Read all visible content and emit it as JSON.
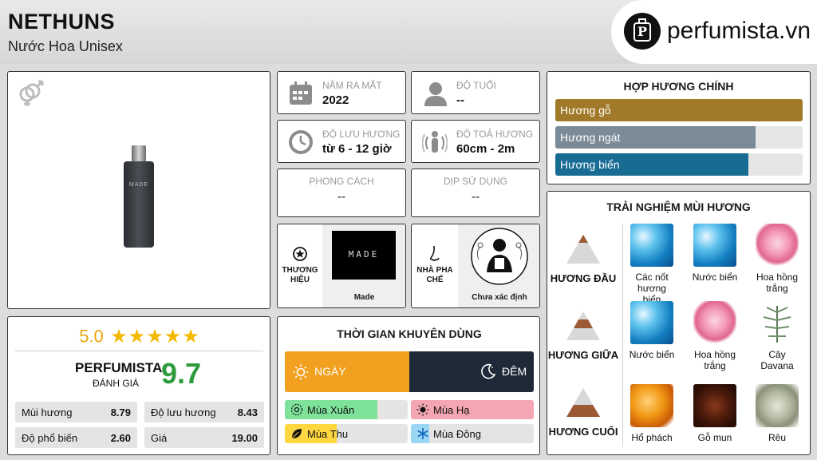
{
  "header": {
    "title": "NETHUNS",
    "subtitle": "Nước Hoa Unisex",
    "logo_text": "perfumista.vn"
  },
  "product": {
    "gender_icon": "unisex-gender-icon",
    "bottle_label": "MADE"
  },
  "rating": {
    "score": "5.0",
    "stars": 5,
    "perfumista_label": "PERFUMISTA",
    "review_label": "ĐÁNH GIÁ",
    "perfumista_score": "9.7",
    "stats": [
      {
        "label": "Mùi hương",
        "value": "8.79"
      },
      {
        "label": "Độ lưu hương",
        "value": "8.43"
      },
      {
        "label": "Độ phổ biến",
        "value": "2.60"
      },
      {
        "label": "Giá",
        "value": "19.00"
      }
    ]
  },
  "info": {
    "year_label": "NĂM RA MẮT",
    "year_value": "2022",
    "age_label": "ĐỘ TUỔI",
    "age_value": "--",
    "longevity_label": "ĐỘ LƯU HƯƠNG",
    "longevity_value": "từ 6 - 12 giờ",
    "sillage_label": "ĐỘ TOẢ HƯƠNG",
    "sillage_value": "60cm - 2m",
    "style_label": "PHONG CÁCH",
    "style_value": "--",
    "occasion_label": "DỊP SỬ DỤNG",
    "occasion_value": "--",
    "brand_label_1": "THƯƠNG",
    "brand_label_2": "HIỆU",
    "brand_name": "Made",
    "brand_logo_text": "MADE",
    "perfumer_label_1": "NHÀ PHA",
    "perfumer_label_2": "CHẾ",
    "perfumer_name": "Chưa xác định"
  },
  "time": {
    "title": "THỜI GIAN KHUYÊN DÙNG",
    "day_label": "NGÀY",
    "night_label": "ĐÊM",
    "day_share": 0.5,
    "seasons": [
      {
        "label": "Mùa Xuân",
        "level": 0.75,
        "color": "#7ee29a",
        "icon": "flower-icon"
      },
      {
        "label": "Mùa Hạ",
        "level": 1.0,
        "color": "#f4a6b2",
        "icon": "sun-icon"
      },
      {
        "label": "Mùa Thu",
        "level": 0.42,
        "color": "#ffd740",
        "icon": "leaf-icon"
      },
      {
        "label": "Mùa Đông",
        "level": 0.15,
        "color": "#9ad7f3",
        "icon": "snowflake-icon"
      }
    ]
  },
  "accords": {
    "title": "HỢP HƯƠNG CHÍNH",
    "items": [
      {
        "label": "Hương gỗ",
        "level": 1.0,
        "color": "#a07a2a"
      },
      {
        "label": "Hương ngát",
        "level": 0.81,
        "color": "#7a8a97"
      },
      {
        "label": "Hương biển",
        "level": 0.78,
        "color": "#186c94"
      }
    ]
  },
  "notes": {
    "title": "TRẢI NGHIỆM MÙI HƯƠNG",
    "top_label": "HƯƠNG ĐẦU",
    "middle_label": "HƯƠNG GIỮA",
    "base_label": "HƯƠNG CUỐI",
    "top": [
      {
        "label": "Các nốt hương biển",
        "img": "wave"
      },
      {
        "label": "Nước biển",
        "img": "wave"
      },
      {
        "label": "Hoa hồng trắng",
        "img": "rose"
      }
    ],
    "middle": [
      {
        "label": "Nước biển",
        "img": "wave"
      },
      {
        "label": "Hoa hồng trắng",
        "img": "rose"
      },
      {
        "label": "Cây Davana",
        "img": "herb"
      }
    ],
    "base": [
      {
        "label": "Hổ phách",
        "img": "amber"
      },
      {
        "label": "Gỗ mun",
        "img": "wood"
      },
      {
        "label": "Rêu",
        "img": "moss"
      }
    ]
  }
}
